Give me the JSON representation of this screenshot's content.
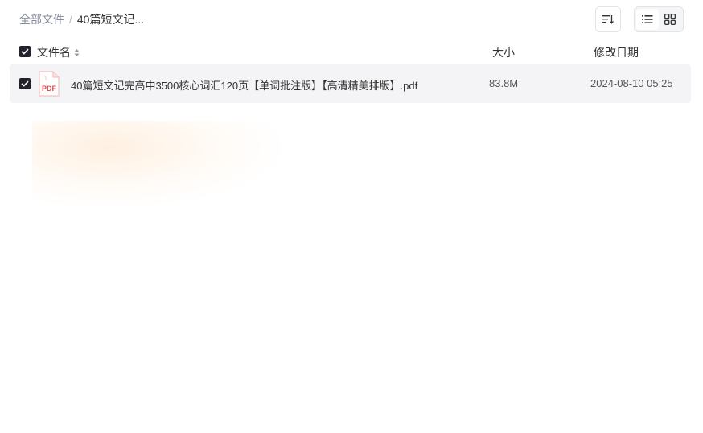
{
  "breadcrumb": {
    "root": "全部文件",
    "separator": "/",
    "current": "40篇短文记..."
  },
  "toolbar": {
    "sort_icon": "sort-lines-icon",
    "list_view_icon": "list-view-icon",
    "grid_view_icon": "grid-view-icon",
    "active_view": "list"
  },
  "table": {
    "columns": {
      "name": "文件名",
      "size": "大小",
      "date": "修改日期"
    },
    "rows": [
      {
        "name": "40篇短文记完高中3500核心词汇120页【单词批注版】【高清精美排版】.pdf",
        "size": "83.8M",
        "date": "2024-08-10 05:25",
        "type": "PDF",
        "checked": true
      }
    ]
  },
  "colors": {
    "checkbox": "#23232b",
    "row_bg": "#f4f4f6",
    "pdf_red": "#e5484d",
    "muted_text": "#878c9c"
  }
}
